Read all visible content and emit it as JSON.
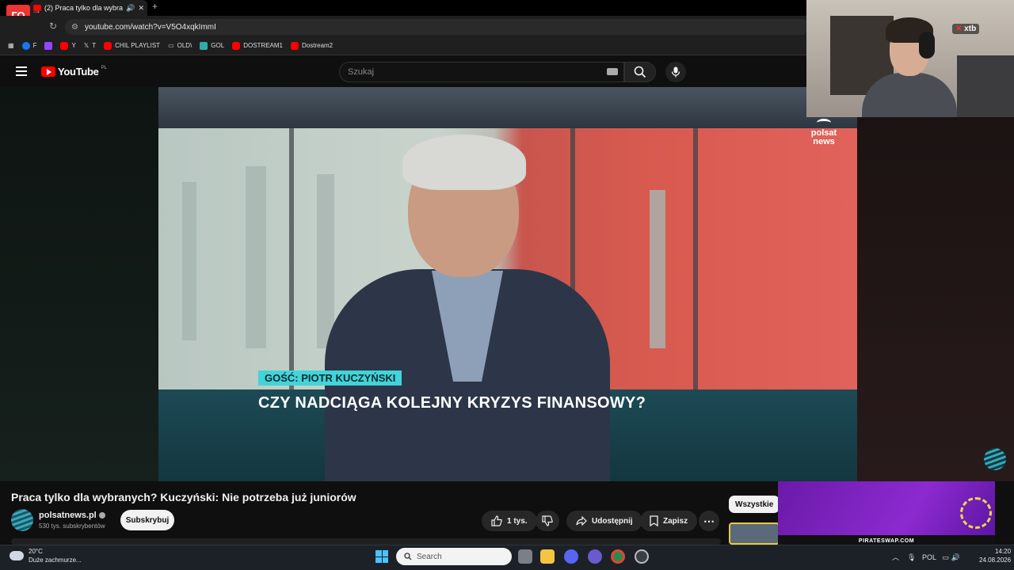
{
  "browser": {
    "tab_title": "(2) Praca tylko dla wybranych? Kuczyński: Nie potrzeba już juniorów",
    "url": "youtube.com/watch?v=V5O4xqkImmI",
    "bookmarks": [
      "F",
      "",
      "Y",
      "T",
      "CHIL PLAYLIST",
      "OLD\\",
      "GOL",
      "DOSTREAM1",
      "Dostream2"
    ]
  },
  "overlay": {
    "channel_logo_text": "ГО",
    "webcam_sponsor": "xtb"
  },
  "youtube": {
    "logo": "YouTube",
    "country_code": "PL",
    "search_placeholder": "Szukaj"
  },
  "video": {
    "lower_third_tag": "GOŚĆ: PIOTR KUCZYŃSKI",
    "lower_third_title": "CZY NADCIĄGA KOLEJNY KRYZYS FINANSOWY?",
    "broadcaster": "polsat news"
  },
  "watch": {
    "title": "Praca tylko dla wybranych? Kuczyński: Nie potrzeba już juniorów",
    "channel_name": "polsatnews.pl",
    "subscribers": "530 tys. subskrybentów",
    "subscribe_label": "Subskrybuj",
    "likes": "1 tys.",
    "share_label": "Udostępnij",
    "save_label": "Zapisz",
    "chip_all": "Wszystkie",
    "ad_text": "PIRATESWAP.COM"
  },
  "taskbar": {
    "temperature": "20°C",
    "weather_desc": "Duże zachmurze...",
    "search_placeholder": "Search",
    "language": "POL",
    "time": "14:20",
    "date": "24.08.2026"
  },
  "colors": {
    "yt_red": "#ff0000",
    "lower_third_tag_bg": "#42d4d8",
    "page_bg": "#0f0f0f"
  }
}
